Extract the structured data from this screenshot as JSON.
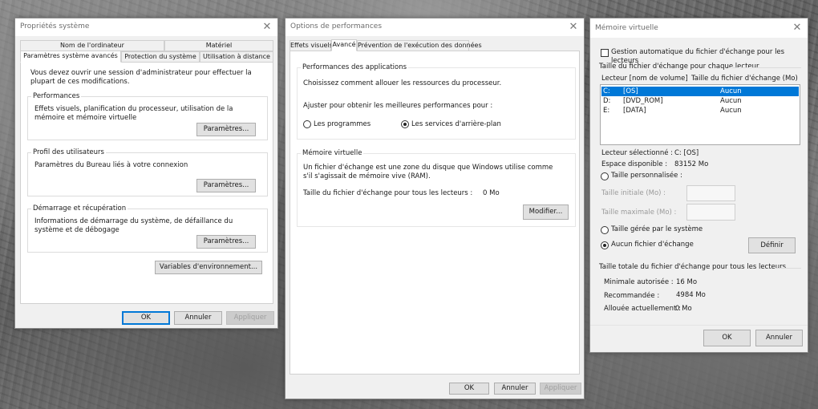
{
  "system_props": {
    "title": "Propriétés système",
    "tabs_row1": [
      "Nom de l'ordinateur",
      "Matériel"
    ],
    "tabs_row2": [
      "Paramètres système avancés",
      "Protection du système",
      "Utilisation à distance"
    ],
    "admin_note": "Vous devez ouvrir une session d'administrateur pour effectuer la plupart de ces modifications.",
    "perf": {
      "label": "Performances",
      "desc": "Effets visuels, planification du processeur, utilisation de la mémoire et mémoire virtuelle",
      "button": "Paramètres..."
    },
    "profile": {
      "label": "Profil des utilisateurs",
      "desc": "Paramètres du Bureau liés à votre connexion",
      "button": "Paramètres..."
    },
    "startup": {
      "label": "Démarrage et récupération",
      "desc": "Informations de démarrage du système, de défaillance du système et de débogage",
      "button": "Paramètres..."
    },
    "env_button": "Variables d'environnement...",
    "ok": "OK",
    "cancel": "Annuler",
    "apply": "Appliquer"
  },
  "perf_options": {
    "title": "Options de performances",
    "tabs": [
      "Effets visuels",
      "Avancé",
      "Prévention de l'exécution des données"
    ],
    "app_perf": {
      "label": "Performances des applications",
      "desc": "Choisissez comment allouer les ressources du processeur.",
      "adjust": "Ajuster pour obtenir les meilleures performances pour :",
      "radio_programs": "Les programmes",
      "radio_services": "Les services d'arrière-plan"
    },
    "virtual_memory": {
      "label": "Mémoire virtuelle",
      "desc": "Un fichier d'échange est une zone du disque que Windows utilise comme s'il s'agissait de mémoire vive (RAM).",
      "size_label": "Taille du fichier d'échange pour tous les lecteurs :",
      "size_value": "0 Mo",
      "modify_button": "Modifier..."
    },
    "ok": "OK",
    "cancel": "Annuler",
    "apply": "Appliquer"
  },
  "virtual_mem": {
    "title": "Mémoire virtuelle",
    "auto_manage": "Gestion automatique du fichier d'échange pour les lecteurs",
    "per_drive_label": "Taille du fichier d'échange pour chaque lecteur",
    "col_drive": "Lecteur [nom de volume]",
    "col_size": "Taille du fichier d'échange (Mo)",
    "drives": [
      {
        "letter": "C:",
        "name": "[OS]",
        "size": "Aucun"
      },
      {
        "letter": "D:",
        "name": "[DVD_ROM]",
        "size": "Aucun"
      },
      {
        "letter": "E:",
        "name": "[DATA]",
        "size": "Aucun"
      }
    ],
    "selected_drive_label": "Lecteur sélectionné :",
    "selected_drive_value": "C:  [OS]",
    "free_space_label": "Espace disponible :",
    "free_space_value": "83152 Mo",
    "custom_size": "Taille personnalisée :",
    "initial_size": "Taille initiale (Mo) :",
    "max_size": "Taille maximale (Mo) :",
    "system_managed": "Taille gérée par le système",
    "no_paging": "Aucun fichier d'échange",
    "set_button": "Définir",
    "total_label": "Taille totale du fichier d'échange pour tous les lecteurs",
    "min_label": "Minimale autorisée :",
    "min_value": "16 Mo",
    "recommended_label": "Recommandée :",
    "recommended_value": "4984 Mo",
    "allocated_label": "Allouée actuellement :",
    "allocated_value": "0 Mo",
    "ok": "OK",
    "cancel": "Annuler"
  },
  "colors": {
    "selection": "#0078d7",
    "dialog_bg": "#f0f0f0"
  },
  "icons": [
    "close-icon"
  ]
}
